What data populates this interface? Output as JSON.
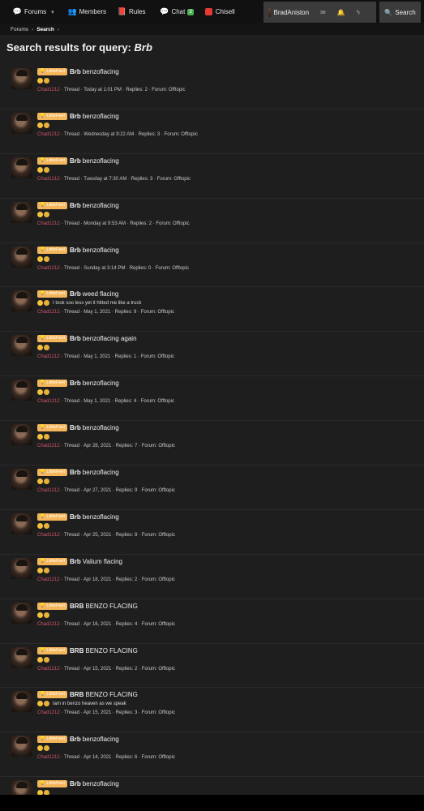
{
  "nav": {
    "forums": "Forums",
    "members": "Members",
    "rules": "Rules",
    "chat": "Chat",
    "chat_badge": "3",
    "chisell": "Chisell",
    "username": "BradAniston",
    "search": "Search"
  },
  "breadcrumb": {
    "root": "Forums",
    "current": "Search"
  },
  "page": {
    "title_prefix": "Search results for query: ",
    "query": "Brb"
  },
  "results": [
    {
      "prefix": "LittleFeet",
      "title_bold": "Brb",
      "title_rest": "benzoflacing",
      "snippet": "",
      "author": "Chad1212",
      "type": "Thread",
      "date": "Today at 1:01 PM",
      "replies": "Replies: 2",
      "forum": "Forum: Offtopic"
    },
    {
      "prefix": "LittleFeet",
      "title_bold": "Brb",
      "title_rest": "benzoflacing",
      "snippet": "",
      "author": "Chad1212",
      "type": "Thread",
      "date": "Wednesday at 9:22 AM",
      "replies": "Replies: 3",
      "forum": "Forum: Offtopic"
    },
    {
      "prefix": "LittleFeet",
      "title_bold": "Brb",
      "title_rest": "benzoflacing",
      "snippet": "",
      "author": "Chad1212",
      "type": "Thread",
      "date": "Tuesday at 7:30 AM",
      "replies": "Replies: 3",
      "forum": "Forum: Offtopic"
    },
    {
      "prefix": "LittleFeet",
      "title_bold": "Brb",
      "title_rest": "benzoflacing",
      "snippet": "",
      "author": "Chad1212",
      "type": "Thread",
      "date": "Monday at 9:53 AM",
      "replies": "Replies: 2",
      "forum": "Forum: Offtopic"
    },
    {
      "prefix": "LittleFeet",
      "title_bold": "Brb",
      "title_rest": "benzoflacing",
      "snippet": "",
      "author": "Chad1212",
      "type": "Thread",
      "date": "Sunday at 3:14 PM",
      "replies": "Replies: 0",
      "forum": "Forum: Offtopic"
    },
    {
      "prefix": "LittleFeet",
      "title_bold": "Brb",
      "title_rest": "weed flacing",
      "snippet": "I took soo less yet it hitted me like a truck",
      "author": "Chad1212",
      "type": "Thread",
      "date": "May 1, 2021",
      "replies": "Replies: 9",
      "forum": "Forum: Offtopic"
    },
    {
      "prefix": "LittleFeet",
      "title_bold": "Brb",
      "title_rest": "benzoflacing again",
      "snippet": "",
      "author": "Chad1212",
      "type": "Thread",
      "date": "May 1, 2021",
      "replies": "Replies: 1",
      "forum": "Forum: Offtopic"
    },
    {
      "prefix": "LittleFeet",
      "title_bold": "Brb",
      "title_rest": "benzoflacing",
      "snippet": "",
      "author": "Chad1212",
      "type": "Thread",
      "date": "May 1, 2021",
      "replies": "Replies: 4",
      "forum": "Forum: Offtopic"
    },
    {
      "prefix": "LittleFeet",
      "title_bold": "Brb",
      "title_rest": "benzoflacing",
      "snippet": "",
      "author": "Chad1212",
      "type": "Thread",
      "date": "Apr 28, 2021",
      "replies": "Replies: 7",
      "forum": "Forum: Offtopic"
    },
    {
      "prefix": "LittleFeet",
      "title_bold": "Brb",
      "title_rest": "benzoflacing",
      "snippet": "",
      "author": "Chad1212",
      "type": "Thread",
      "date": "Apr 27, 2021",
      "replies": "Replies: 9",
      "forum": "Forum: Offtopic"
    },
    {
      "prefix": "LittleFeet",
      "title_bold": "Brb",
      "title_rest": "benzoflacing",
      "snippet": "",
      "author": "Chad1212",
      "type": "Thread",
      "date": "Apr 25, 2021",
      "replies": "Replies: 8",
      "forum": "Forum: Offtopic"
    },
    {
      "prefix": "LittleFeet",
      "title_bold": "Brb",
      "title_rest": "Valium flacing",
      "snippet": "",
      "author": "Chad1212",
      "type": "Thread",
      "date": "Apr 18, 2021",
      "replies": "Replies: 2",
      "forum": "Forum: Offtopic"
    },
    {
      "prefix": "LittleFeet",
      "title_bold": "BRB",
      "title_rest": "BENZO FLACING",
      "snippet": "",
      "author": "Chad1212",
      "type": "Thread",
      "date": "Apr 16, 2021",
      "replies": "Replies: 4",
      "forum": "Forum: Offtopic"
    },
    {
      "prefix": "LittleFeet",
      "title_bold": "BRB",
      "title_rest": "BENZO FLACING",
      "snippet": "",
      "author": "Chad1212",
      "type": "Thread",
      "date": "Apr 15, 2021",
      "replies": "Replies: 2",
      "forum": "Forum: Offtopic"
    },
    {
      "prefix": "LittleFeet",
      "title_bold": "BRB",
      "title_rest": "BENZO FLACING",
      "snippet": "Iam in benzo heaven as we speak",
      "author": "Chad1212",
      "type": "Thread",
      "date": "Apr 15, 2021",
      "replies": "Replies: 3",
      "forum": "Forum: Offtopic"
    },
    {
      "prefix": "LittleFeet",
      "title_bold": "Brb",
      "title_rest": "benzoflacing",
      "snippet": "",
      "author": "Chad1212",
      "type": "Thread",
      "date": "Apr 14, 2021",
      "replies": "Replies: 6",
      "forum": "Forum: Offtopic"
    },
    {
      "prefix": "LittleFeet",
      "title_bold": "Brb",
      "title_rest": "benzoflacing",
      "snippet": "",
      "author": "",
      "type": "",
      "date": "",
      "replies": "",
      "forum": ""
    }
  ]
}
